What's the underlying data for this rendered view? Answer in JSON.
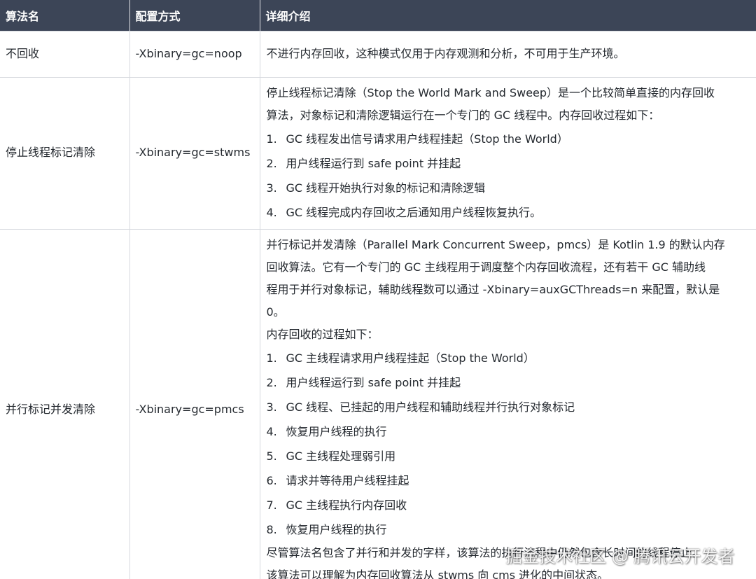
{
  "headers": [
    "算法名",
    "配置方式",
    "详细介绍"
  ],
  "rows": [
    {
      "name": "不回收",
      "config": "-Xbinary=gc=noop",
      "intro": [
        "不进行内存回收，这种模式仅用于内存观测和分析，不可用于生产环境。"
      ],
      "steps": [],
      "outro": []
    },
    {
      "name": "停止线程标记清除",
      "config": "-Xbinary=gc=stwms",
      "intro": [
        "停止线程标记清除（Stop the World Mark and Sweep）是一个比较简单直接的内存回收",
        "算法，对象标记和清除逻辑运行在一个专门的 GC 线程中。内存回收过程如下："
      ],
      "steps": [
        {
          "num": "1.",
          "text": "GC 线程发出信号请求用户线程挂起（Stop the World）"
        },
        {
          "num": "2.",
          "text": "用户线程运行到 safe point 并挂起"
        },
        {
          "num": "3.",
          "text": "GC 线程开始执行对象的标记和清除逻辑"
        },
        {
          "num": "4.",
          "text": "GC 线程完成内存回收之后通知用户线程恢复执行。"
        }
      ],
      "outro": []
    },
    {
      "name": "并行标记并发清除",
      "config": "-Xbinary=gc=pmcs",
      "intro": [
        "并行标记并发清除（Parallel Mark Concurrent Sweep，pmcs）是 Kotlin 1.9 的默认内存",
        "回收算法。它有一个专门的 GC 主线程用于调度整个内存回收流程，还有若干 GC 辅助线",
        "程用于并行对象标记，辅助线程数可以通过 -Xbinary=auxGCThreads=n 来配置，默认是",
        "0。",
        "内存回收的过程如下："
      ],
      "steps": [
        {
          "num": "1.",
          "text": "GC 主线程请求用户线程挂起（Stop the World）"
        },
        {
          "num": "2.",
          "text": "用户线程运行到 safe point 并挂起"
        },
        {
          "num": "3.",
          "text": "GC 线程、已挂起的用户线程和辅助线程并行执行对象标记"
        },
        {
          "num": "4.",
          "text": "恢复用户线程的执行"
        },
        {
          "num": "5.",
          "text": "GC 主线程处理弱引用"
        },
        {
          "num": "6.",
          "text": "请求并等待用户线程挂起"
        },
        {
          "num": "7.",
          "text": "GC 主线程执行内存回收"
        },
        {
          "num": "8.",
          "text": "恢复用户线程的执行"
        }
      ],
      "outro": [
        "尽管算法名包含了并行和并发的字样，该算法的执行流程中仍然包含长时间的线程停止。",
        "该算法可以理解为内存回收算法从 stwms 向 cms 进化的中间状态。"
      ]
    }
  ],
  "watermark": "掘金技术社区 @ 腾讯云开发者"
}
